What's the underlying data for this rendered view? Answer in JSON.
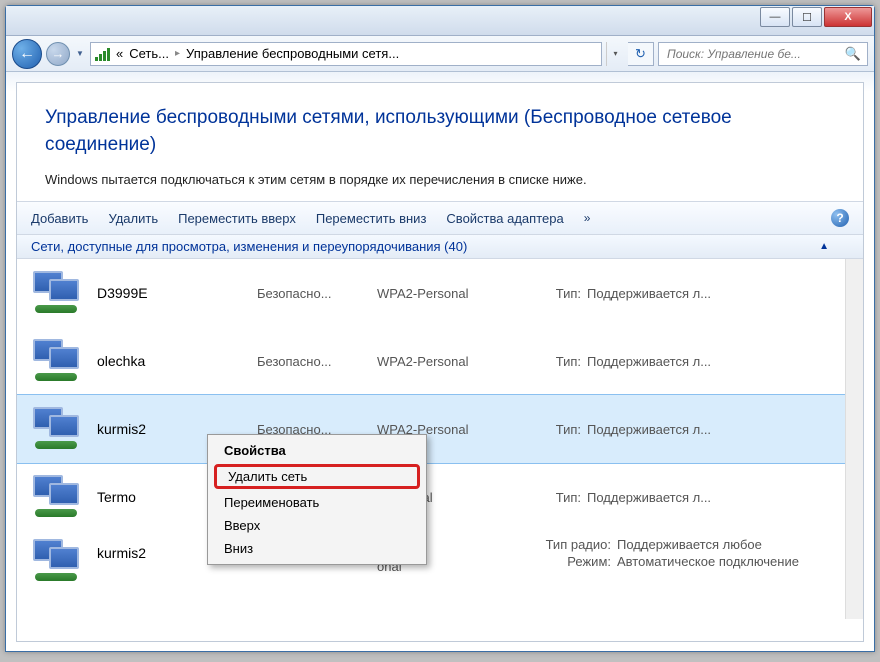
{
  "titlebar": {
    "minimize": "—",
    "maximize": "☐",
    "close": "X"
  },
  "nav": {
    "back_glyph": "←",
    "fwd_glyph": "→",
    "drop_glyph": "▼"
  },
  "path": {
    "prefix": "«",
    "seg1": "Сеть...",
    "sep": "▸",
    "seg2": "Управление беспроводными сетя...",
    "drop_glyph": "▾",
    "refresh_glyph": "↻"
  },
  "search": {
    "placeholder": "Поиск: Управление бе..."
  },
  "header": {
    "title": "Управление беспроводными сетями, использующими (Беспроводное сетевое соединение)",
    "desc": "Windows пытается подключаться к этим сетям в порядке их перечисления в списке ниже."
  },
  "toolbar": {
    "add": "Добавить",
    "remove": "Удалить",
    "move_up": "Переместить вверх",
    "move_down": "Переместить вниз",
    "adapter_props": "Свойства адаптера",
    "overflow": "»",
    "help": "?"
  },
  "group": {
    "label": "Сети, доступные для просмотра, изменения и переупорядочивания (40)",
    "caret": "▲"
  },
  "cols": {
    "security_label": "Безопасно...",
    "type_label": "Тип:",
    "type_value": "Поддерживается л...",
    "radio_type_label": "Тип радио:",
    "radio_type_value": "Поддерживается любое",
    "mode_label": "Режим:",
    "mode_value": "Автоматическое подключение"
  },
  "networks": [
    {
      "name": "D3999E",
      "sec": "WPA2-Personal"
    },
    {
      "name": "olechka",
      "sec": "WPA2-Personal"
    },
    {
      "name": "kurmis2",
      "sec": "WPA2-Personal",
      "selected": true
    },
    {
      "name": "Termo",
      "sec": "-Personal"
    },
    {
      "name": "kurmis2",
      "sec": "onal",
      "special": true
    }
  ],
  "context_menu": {
    "properties": "Свойства",
    "delete": "Удалить сеть",
    "rename": "Переименовать",
    "up": "Вверх",
    "down": "Вниз"
  }
}
